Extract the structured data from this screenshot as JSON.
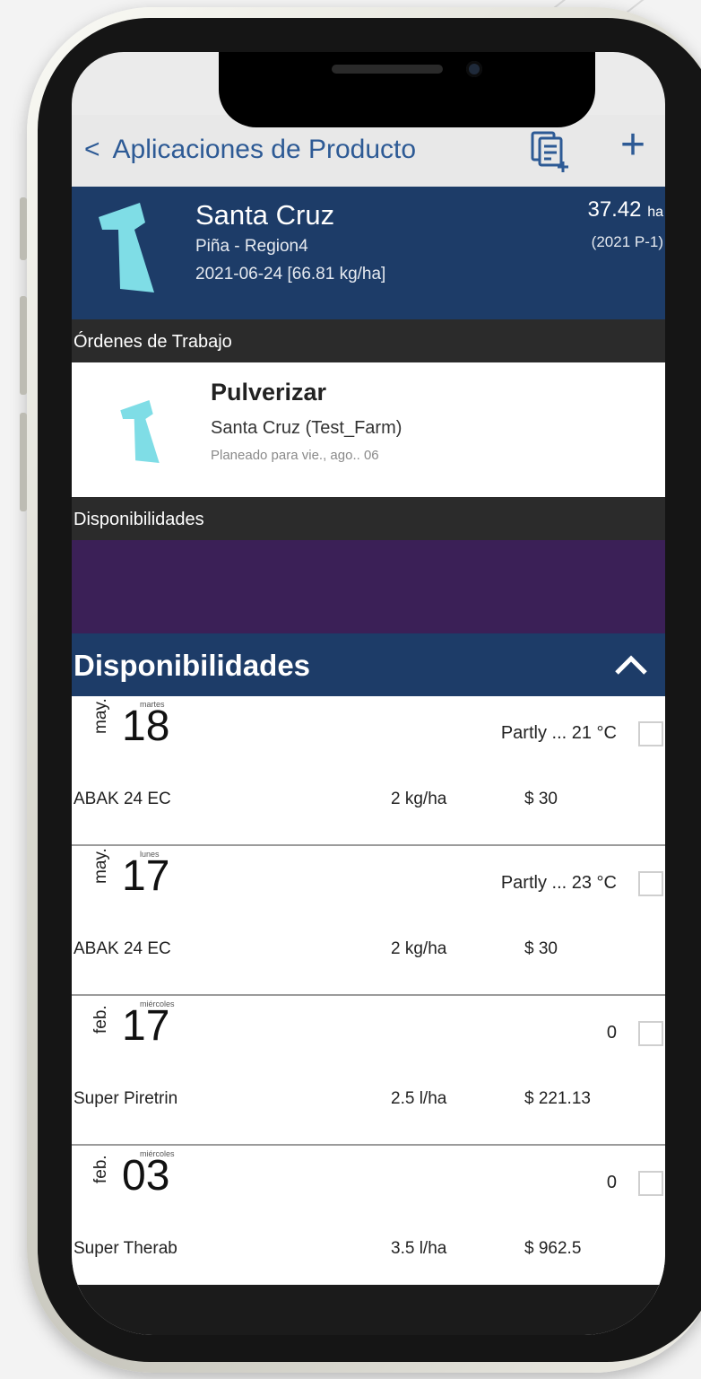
{
  "header": {
    "back_icon": "chevron-left-icon",
    "title": "Aplicaciones de Producto",
    "copy_icon": "copy-document-add-icon",
    "add_icon": "plus-icon"
  },
  "field": {
    "name": "Santa Cruz",
    "crop": "Piña - Region4",
    "date_rate": "2021-06-24 [66.81 kg/ha]",
    "area": "37.42",
    "area_unit": "ha",
    "season": "(2021 P-1)"
  },
  "work_orders": {
    "section_label": "Órdenes de Trabajo",
    "items": [
      {
        "title": "Pulverizar",
        "location": "Santa Cruz (Test_Farm)",
        "planned": "Planeado para vie., ago.. 06"
      }
    ]
  },
  "availability_bar": {
    "label": "Disponibilidades"
  },
  "availability": {
    "title": "Disponibilidades",
    "toggle_icon": "chevron-up-icon",
    "rows": [
      {
        "month": "may.",
        "weekday": "martes",
        "day": "18",
        "weather": "Partly ... 21 °C",
        "product": "ABAK 24 EC",
        "rate": "2 kg/ha",
        "cost": "$ 30"
      },
      {
        "month": "may.",
        "weekday": "lunes",
        "day": "17",
        "weather": "Partly ... 23 °C",
        "product": "ABAK 24 EC",
        "rate": "2 kg/ha",
        "cost": "$ 30"
      },
      {
        "month": "feb.",
        "weekday": "miércoles",
        "day": "17",
        "weather": "0",
        "product": "Super Piretrin",
        "rate": "2.5 l/ha",
        "cost": "$ 221.13"
      },
      {
        "month": "feb.",
        "weekday": "miércoles",
        "day": "03",
        "weather": "0",
        "product": "Super Therab",
        "rate": "3.5 l/ha",
        "cost": "$ 962.5"
      }
    ]
  },
  "colors": {
    "header_blue": "#1d3c68",
    "link_blue": "#2d5a95",
    "section_dark": "#2b2b2b",
    "purple": "#3b2057",
    "field_shape": "#7fdde6"
  }
}
